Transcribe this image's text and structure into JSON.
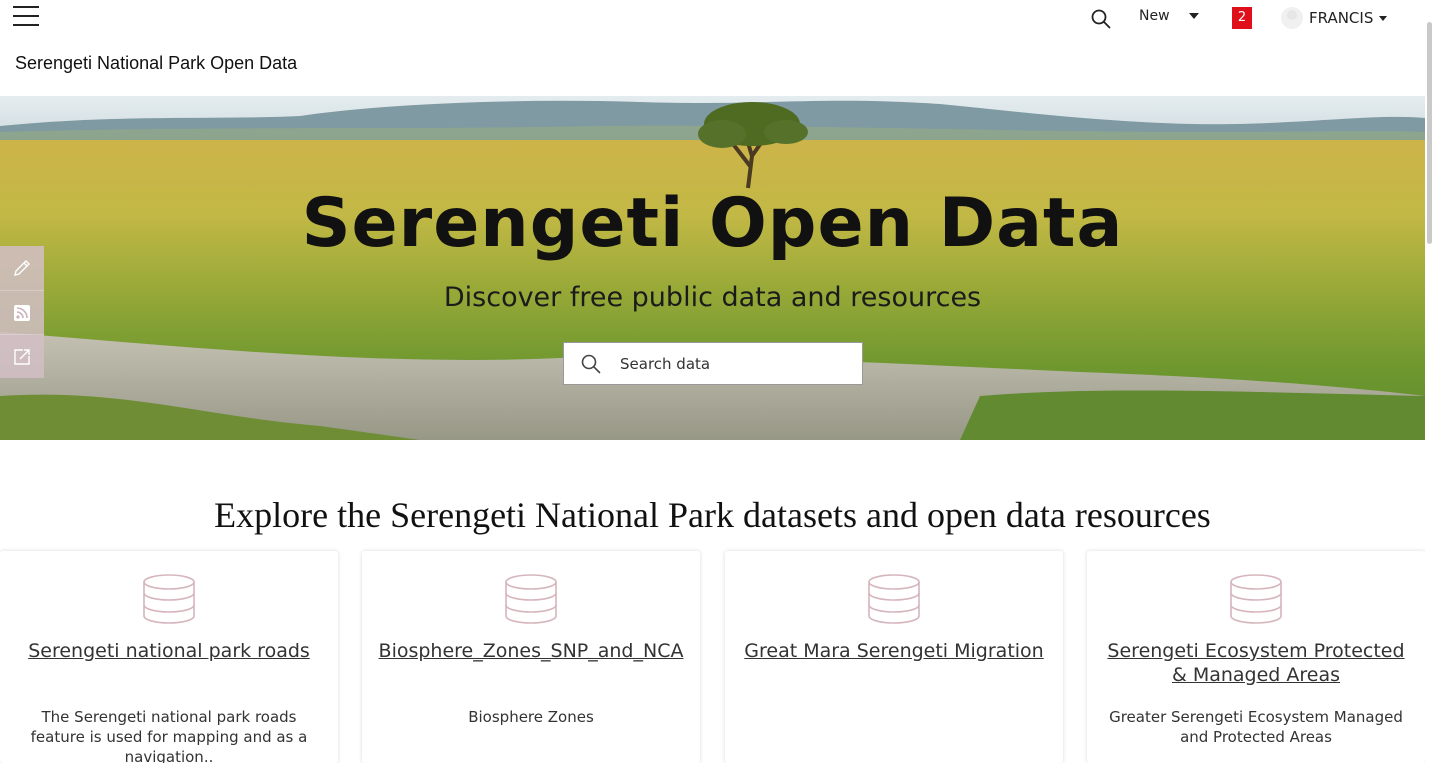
{
  "header": {
    "menu_icon": "hamburger-menu-icon",
    "search_icon": "search-icon",
    "new_label": "New",
    "notification_count": "2",
    "user_name": "FRANCIS"
  },
  "site": {
    "title": "Serengeti National Park Open Data"
  },
  "hero": {
    "title": "Serengeti Open Data",
    "subtitle": "Discover free public data and resources",
    "search_placeholder": "Search data"
  },
  "side_tools": [
    "pencil-icon",
    "rss-icon",
    "share-icon"
  ],
  "explore": {
    "heading": "Explore the Serengeti National Park datasets and open data resources"
  },
  "cards": [
    {
      "title": "Serengeti national park roads",
      "description": "The Serengeti national park roads feature is used for mapping and as a navigation.."
    },
    {
      "title": "Biosphere_Zones_SNP_and_NCA",
      "description": "Biosphere Zones"
    },
    {
      "title": "Great Mara Serengeti Migration",
      "description": ""
    },
    {
      "title": "Serengeti Ecosystem Protected & Managed Areas",
      "description": "Greater Serengeti Ecosystem Managed and Protected Areas"
    }
  ],
  "colors": {
    "notification_badge": "#e0101a",
    "side_toolbar": "#d2bec6",
    "card_icon": "#d6b6bd"
  }
}
